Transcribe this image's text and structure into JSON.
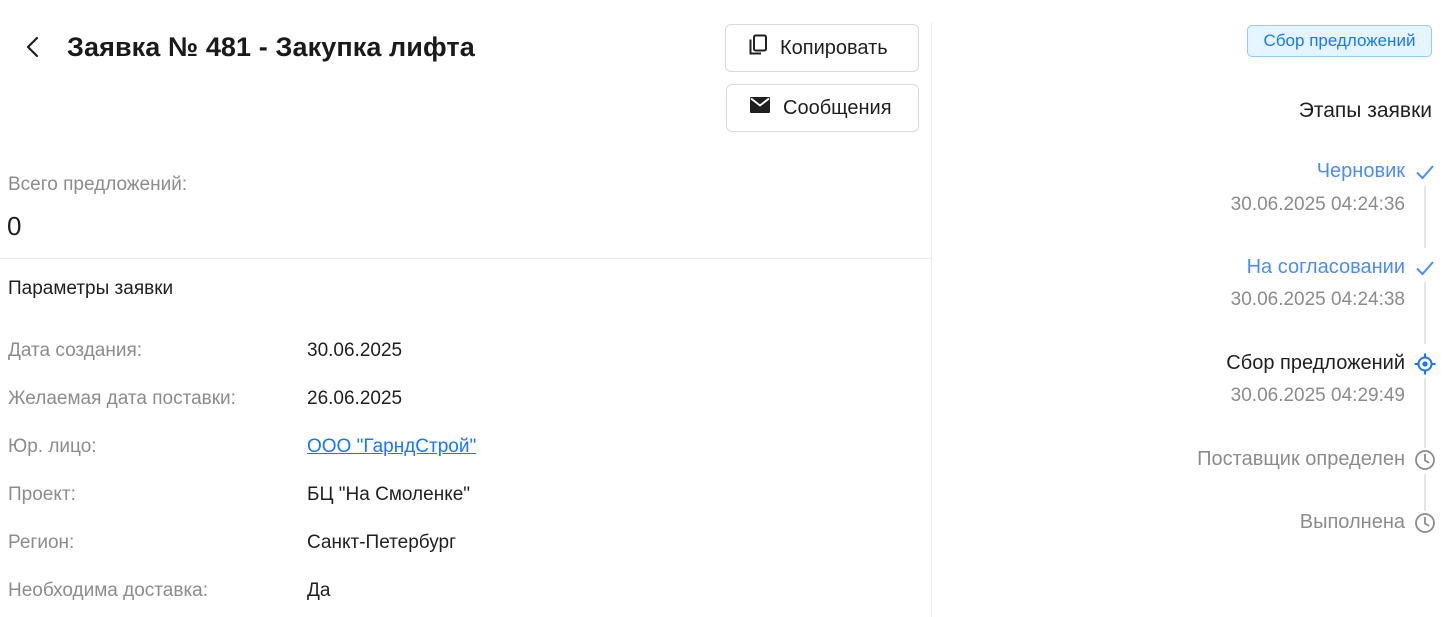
{
  "header": {
    "back_icon": "chevron-left-icon",
    "title": "Заявка № 481 - Закупка лифта",
    "copy_label": "Копировать",
    "copy_icon": "copy-icon",
    "messages_label": "Сообщения",
    "messages_icon": "mail-icon"
  },
  "summary": {
    "total_label": "Всего предложений:",
    "total_value": "0"
  },
  "params": {
    "title": "Параметры заявки",
    "rows": [
      {
        "label": "Дата создания:",
        "value": "30.06.2025"
      },
      {
        "label": "Желаемая дата поставки:",
        "value": "26.06.2025"
      },
      {
        "label": "Юр. лицо:",
        "value": "ООО \"ГарндСтрой\""
      },
      {
        "label": "Проект:",
        "value": "БЦ \"На Смоленке\""
      },
      {
        "label": "Регион:",
        "value": "Санкт-Петербург"
      },
      {
        "label": "Необходима доставка:",
        "value": "Да"
      }
    ]
  },
  "status": {
    "badge": "Сбор предложений",
    "badge_color": "#1677ff"
  },
  "stages": {
    "title": "Этапы заявки",
    "items": [
      {
        "name": "Черновик",
        "date": "30.06.2025 04:24:36",
        "state": "done",
        "icon": "check-icon"
      },
      {
        "name": "На согласовании",
        "date": "30.06.2025 04:24:38",
        "state": "done",
        "icon": "check-icon"
      },
      {
        "name": "Сбор предложений",
        "date": "30.06.2025 04:29:49",
        "state": "current",
        "icon": "target-icon"
      },
      {
        "name": "Поставщик определен",
        "date": "",
        "state": "pending",
        "icon": "clock-icon"
      },
      {
        "name": "Выполнена",
        "date": "",
        "state": "pending",
        "icon": "clock-icon"
      }
    ],
    "colors": {
      "done": "#4b8df8",
      "current": "#1677ff",
      "pending": "#8c8c8c"
    }
  }
}
